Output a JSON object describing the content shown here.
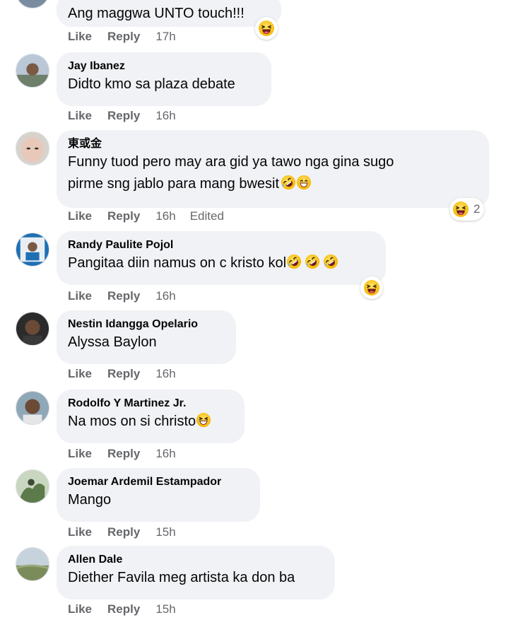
{
  "actions": {
    "like": "Like",
    "reply": "Reply",
    "edited": "Edited"
  },
  "comments": [
    {
      "author": "",
      "text": "Ang maggwa UNTO touch!!!",
      "time": "17h",
      "reaction_icon": "laughing-face-icon"
    },
    {
      "author": "Jay Ibanez",
      "text": "Didto kmo sa plaza debate",
      "time": "16h"
    },
    {
      "author": "東或金",
      "text_lines": [
        "Funny tuod pero may ara gid ya tawo nga gina sugo",
        "pirme sng jablo para mang bwesit"
      ],
      "text_emojis": [
        "rofl-emoji",
        "grin-emoji"
      ],
      "time": "16h",
      "edited": true,
      "reaction_icon": "laughing-face-icon",
      "reaction_count": "2"
    },
    {
      "author": "Randy Paulite Pojol",
      "text": "Pangitaa diin namus on c kristo kol",
      "text_emojis": [
        "rofl-emoji",
        "rofl-emoji",
        "rofl-emoji"
      ],
      "time": "16h",
      "reaction_icon": "laughing-face-icon"
    },
    {
      "author": "Nestin Idangga Opelario",
      "text": "Alyssa Baylon",
      "time": "16h"
    },
    {
      "author": "Rodolfo Y Martinez Jr.",
      "text": "Na mos on si christo",
      "text_emojis": [
        "laughing-squint-emoji"
      ],
      "time": "16h"
    },
    {
      "author": "Joemar Ardemil Estampador",
      "text": "Mango",
      "time": "15h"
    },
    {
      "author": "Allen Dale",
      "text": "Diether Favila meg artista ka don ba",
      "time": "15h"
    }
  ]
}
